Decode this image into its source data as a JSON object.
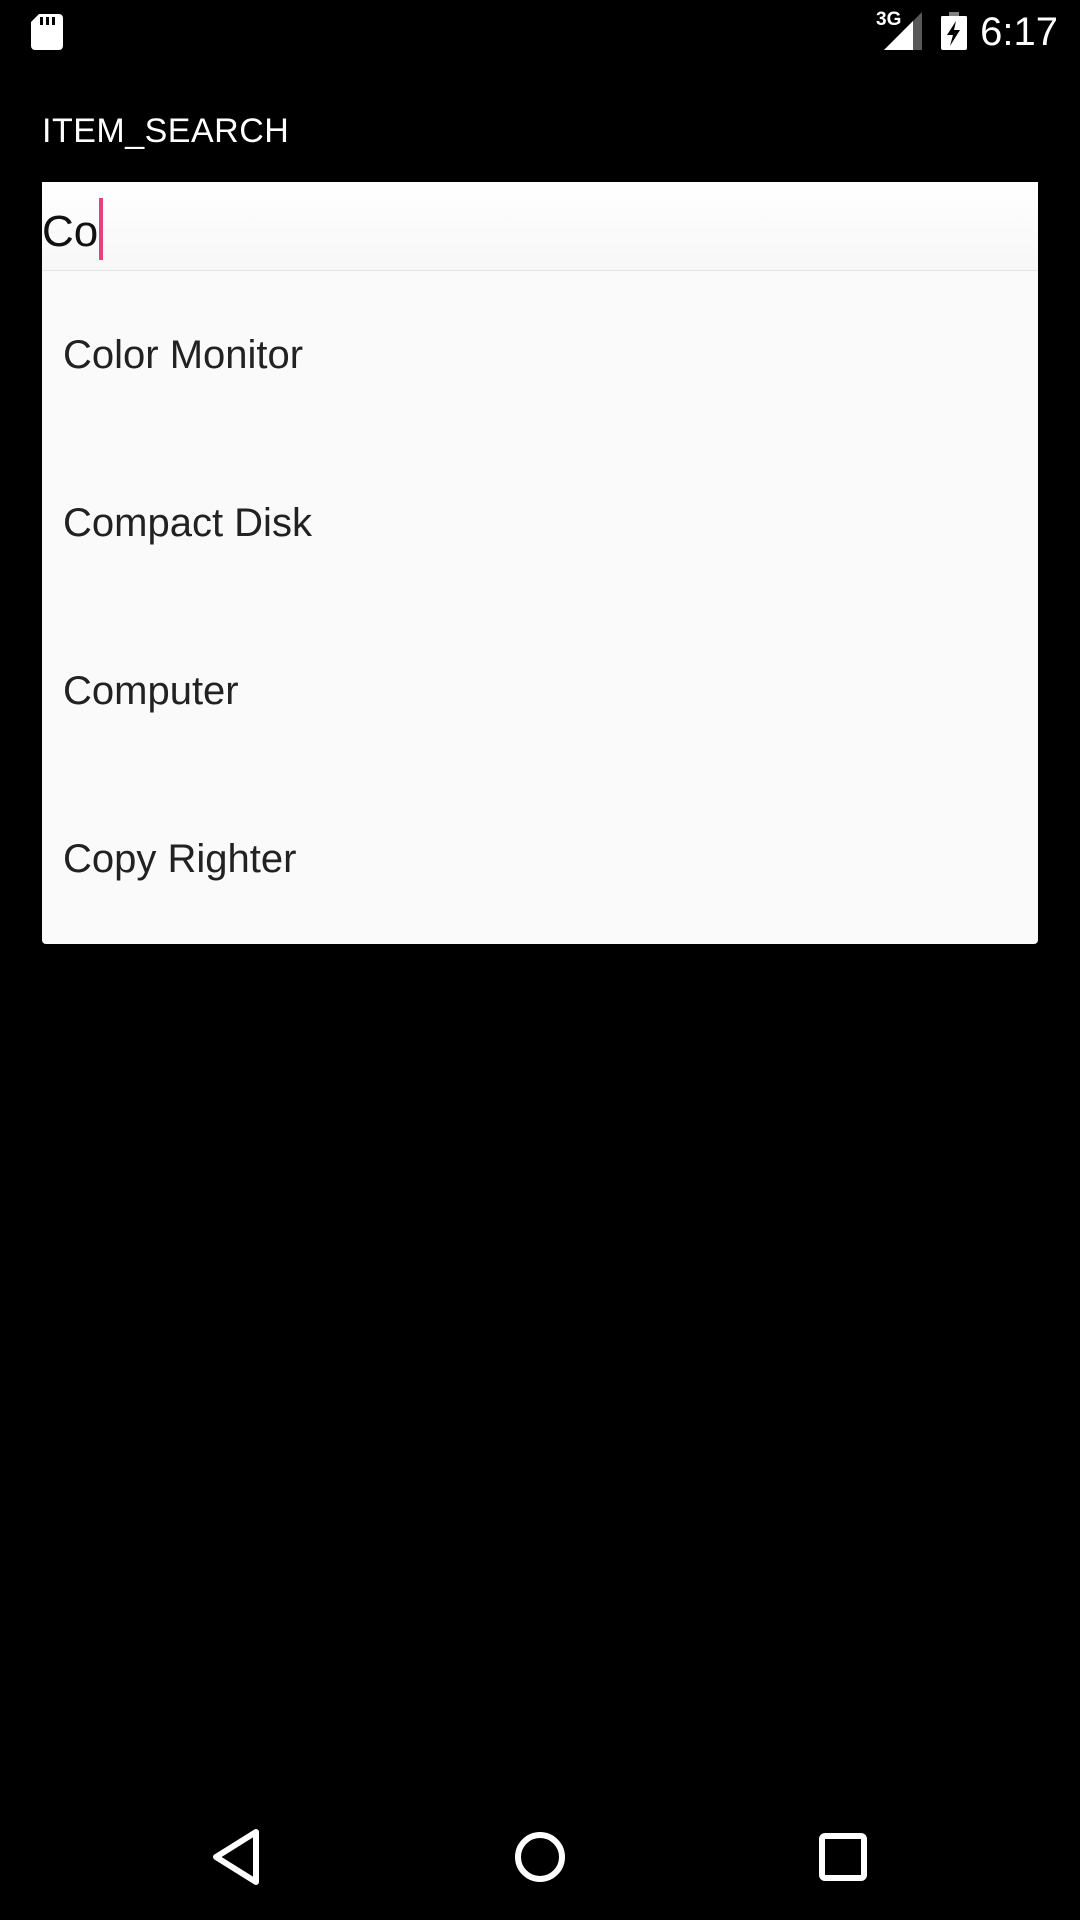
{
  "status_bar": {
    "network_type": "3G",
    "time": "6:17",
    "icons": [
      "sd-card-icon",
      "signal-icon",
      "battery-charging-icon"
    ]
  },
  "screen": {
    "title": "ITEM_SEARCH"
  },
  "search": {
    "value": "Co",
    "cursor_color": "#e8407b"
  },
  "suggestions": [
    {
      "label": "Color Monitor"
    },
    {
      "label": "Compact Disk"
    },
    {
      "label": "Computer"
    },
    {
      "label": "Copy Righter"
    }
  ],
  "navigation": {
    "icons": [
      "back-icon",
      "home-icon",
      "recents-icon"
    ]
  },
  "colors": {
    "background": "#000000",
    "dropdown_background": "#fafafa",
    "accent": "#e8407b"
  }
}
